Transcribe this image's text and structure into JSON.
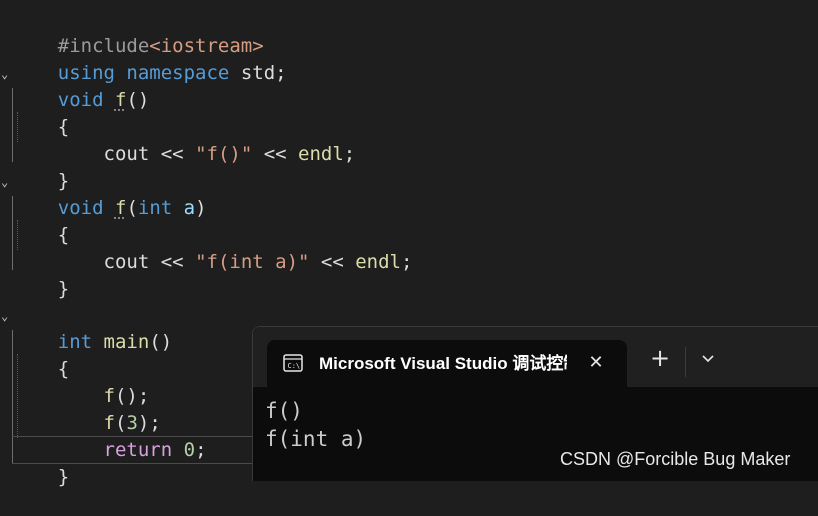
{
  "editor": {
    "lines": [
      [
        "#include",
        "<iostream>"
      ],
      [
        "using",
        " ",
        "namespace",
        " ",
        "std",
        ";"
      ],
      [
        "void",
        " ",
        "f",
        "()"
      ],
      [
        "{"
      ],
      [
        "    ",
        "cout",
        " << ",
        "\"f()\"",
        " << ",
        "endl",
        ";"
      ],
      [
        "}"
      ],
      [
        "void",
        " ",
        "f",
        "(",
        "int",
        " ",
        "a",
        ")"
      ],
      [
        "{"
      ],
      [
        "    ",
        "cout",
        " << ",
        "\"f(int a)\"",
        " << ",
        "endl",
        ";"
      ],
      [
        "}"
      ],
      [
        ""
      ],
      [
        "int",
        " ",
        "main",
        "()"
      ],
      [
        "{"
      ],
      [
        "    ",
        "f",
        "();"
      ],
      [
        "    ",
        "f",
        "(",
        "3",
        ");"
      ],
      [
        "    ",
        "return",
        " ",
        "0",
        ";"
      ],
      [
        "}"
      ]
    ],
    "fold_icon": "chevron-down-icon"
  },
  "console": {
    "title": "Microsoft Visual Studio 调试控制台",
    "tab_icon": "terminal-icon",
    "close_label": "✕",
    "new_tab_label": "+",
    "dropdown_icon": "chevron-down-icon",
    "output": [
      "f()",
      "f(int a)"
    ]
  },
  "watermark": "CSDN @Forcible Bug Maker"
}
